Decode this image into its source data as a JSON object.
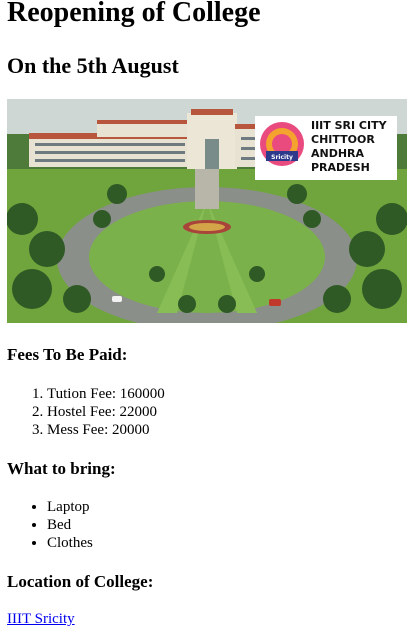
{
  "page": {
    "title": "Reopening of College",
    "subtitle": "On the 5th August"
  },
  "banner": {
    "logo_lines": [
      "IIIT SRI CITY",
      "CHITTOOR",
      "ANDHRA",
      "PRADESH"
    ],
    "seal_text": "Sricity"
  },
  "fees": {
    "heading": "Fees To Be Paid:",
    "items": [
      "Tution Fee: 160000",
      "Hostel Fee: 22000",
      "Mess Fee: 20000"
    ]
  },
  "bring": {
    "heading": "What to bring:",
    "items": [
      "Laptop",
      "Bed",
      "Clothes"
    ]
  },
  "location": {
    "heading": "Location of College:",
    "link_text": "IIIT Sricity"
  },
  "colors": {
    "link": "#0000ee",
    "sky": "#cfd7d4",
    "lawn": "#6fa53c",
    "roof": "#b8553d",
    "building": "#e8e2d2"
  }
}
